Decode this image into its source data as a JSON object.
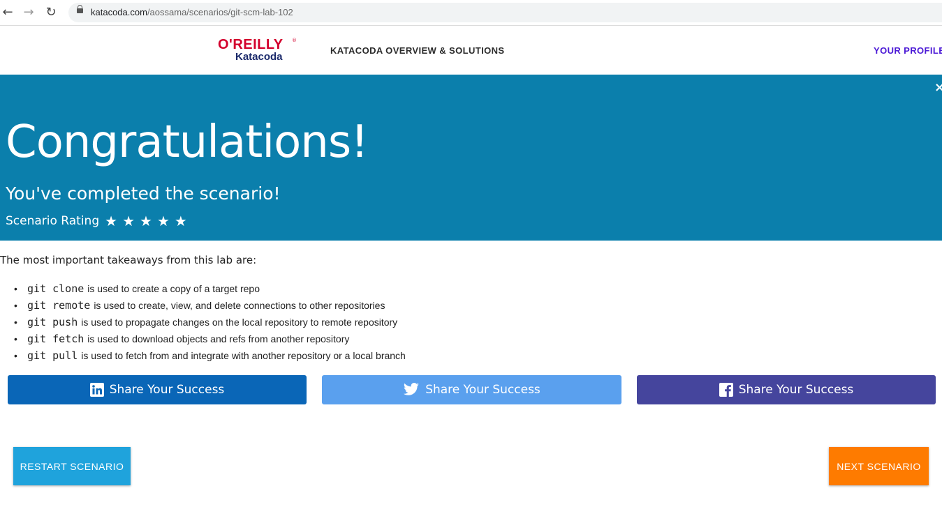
{
  "browser": {
    "url_domain": "katacoda.com",
    "url_path": "/aossama/scenarios/git-scm-lab-102"
  },
  "header": {
    "logo_top": "O'REILLY",
    "logo_reg": "®",
    "logo_bottom": "Katacoda",
    "nav_overview": "KATACODA OVERVIEW & SOLUTIONS",
    "nav_profile": "YOUR PROFILE"
  },
  "banner": {
    "close": "×",
    "title": "Congratulations!",
    "subtitle": "You've completed the scenario!",
    "rating_label": "Scenario Rating",
    "rating_stars": 5,
    "background": "#0b7fac"
  },
  "takeaways": {
    "intro": "The most important takeaways from this lab are:",
    "items": [
      {
        "code": "git clone",
        "text": "is used to create a copy of a target repo"
      },
      {
        "code": "git remote",
        "text": "is used to create, view, and delete connections to other repositories"
      },
      {
        "code": "git push",
        "text": "is used to propagate changes on the local repository to remote repository"
      },
      {
        "code": "git fetch",
        "text": "is used to download objects and refs from another repository"
      },
      {
        "code": "git pull",
        "text": "is used to fetch from and integrate with another repository or a local branch"
      }
    ]
  },
  "share": {
    "linkedin_label": "Share Your Success",
    "twitter_label": "Share Your Success",
    "facebook_label": "Share Your Success",
    "colors": {
      "linkedin": "#0a66b7",
      "twitter": "#5aa0ee",
      "facebook": "#45459d"
    }
  },
  "actions": {
    "restart_label": "RESTART SCENARIO",
    "next_label": "NEXT SCENARIO",
    "colors": {
      "restart": "#1fa3dc",
      "next": "#fe7b00"
    }
  }
}
